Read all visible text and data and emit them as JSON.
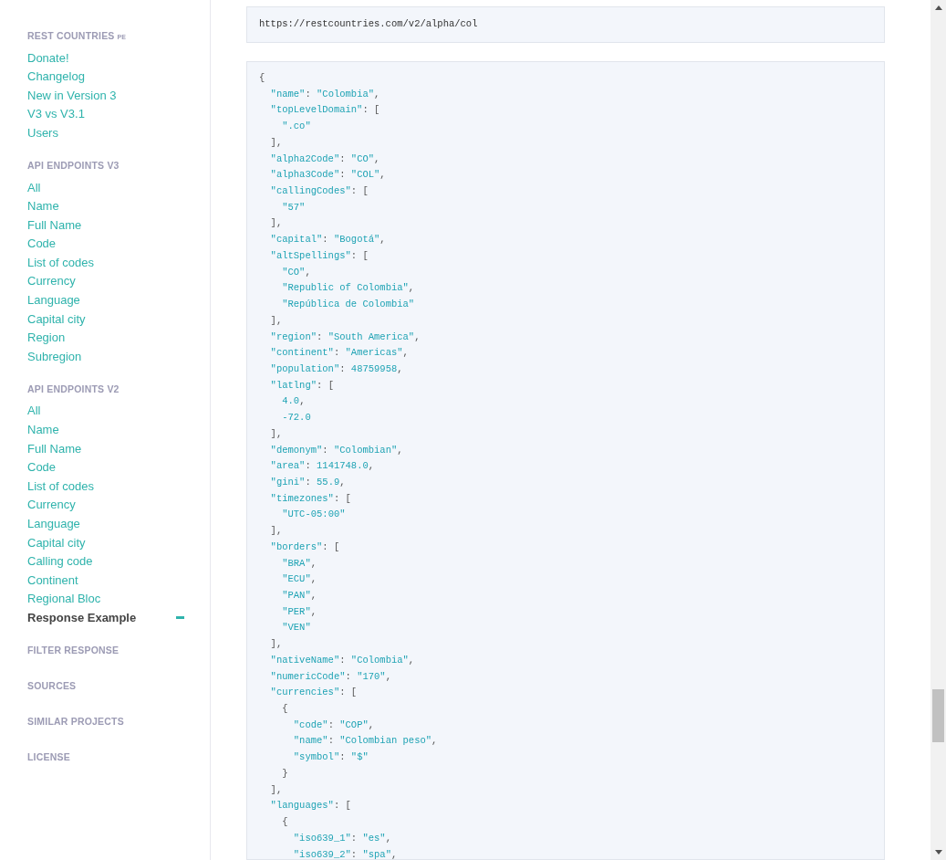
{
  "sidebar": {
    "sections": [
      {
        "title": "REST COUNTRIES",
        "title_suffix": "PE",
        "items": [
          {
            "label": "Donate!",
            "selected": false
          },
          {
            "label": "Changelog",
            "selected": false
          },
          {
            "label": "New in Version 3",
            "selected": false
          },
          {
            "label": "V3 vs V3.1",
            "selected": false
          },
          {
            "label": "Users",
            "selected": false
          }
        ]
      },
      {
        "title": "API ENDPOINTS V3",
        "items": [
          {
            "label": "All",
            "selected": false
          },
          {
            "label": "Name",
            "selected": false
          },
          {
            "label": "Full Name",
            "selected": false
          },
          {
            "label": "Code",
            "selected": false
          },
          {
            "label": "List of codes",
            "selected": false
          },
          {
            "label": "Currency",
            "selected": false
          },
          {
            "label": "Language",
            "selected": false
          },
          {
            "label": "Capital city",
            "selected": false
          },
          {
            "label": "Region",
            "selected": false
          },
          {
            "label": "Subregion",
            "selected": false
          }
        ]
      },
      {
        "title": "API ENDPOINTS V2",
        "items": [
          {
            "label": "All",
            "selected": false
          },
          {
            "label": "Name",
            "selected": false
          },
          {
            "label": "Full Name",
            "selected": false
          },
          {
            "label": "Code",
            "selected": false
          },
          {
            "label": "List of codes",
            "selected": false
          },
          {
            "label": "Currency",
            "selected": false
          },
          {
            "label": "Language",
            "selected": false
          },
          {
            "label": "Capital city",
            "selected": false
          },
          {
            "label": "Calling code",
            "selected": false
          },
          {
            "label": "Continent",
            "selected": false
          },
          {
            "label": "Regional Bloc",
            "selected": false
          },
          {
            "label": "Response Example",
            "selected": true
          }
        ]
      },
      {
        "title": "FILTER RESPONSE"
      },
      {
        "title": "SOURCES"
      },
      {
        "title": "SIMILAR PROJECTS"
      },
      {
        "title": "LICENSE"
      }
    ]
  },
  "main": {
    "url": "https://restcountries.com/v2/alpha/col",
    "code": "{\n  \"name\": \"Colombia\",\n  \"topLevelDomain\": [\n    \".co\"\n  ],\n  \"alpha2Code\": \"CO\",\n  \"alpha3Code\": \"COL\",\n  \"callingCodes\": [\n    \"57\"\n  ],\n  \"capital\": \"Bogotá\",\n  \"altSpellings\": [\n    \"CO\",\n    \"Republic of Colombia\",\n    \"República de Colombia\"\n  ],\n  \"region\": \"South America\",\n  \"continent\": \"Americas\",\n  \"population\": 48759958,\n  \"latlng\": [\n    4.0,\n    -72.0\n  ],\n  \"demonym\": \"Colombian\",\n  \"area\": 1141748.0,\n  \"gini\": 55.9,\n  \"timezones\": [\n    \"UTC-05:00\"\n  ],\n  \"borders\": [\n    \"BRA\",\n    \"ECU\",\n    \"PAN\",\n    \"PER\",\n    \"VEN\"\n  ],\n  \"nativeName\": \"Colombia\",\n  \"numericCode\": \"170\",\n  \"currencies\": [\n    {\n      \"code\": \"COP\",\n      \"name\": \"Colombian peso\",\n      \"symbol\": \"$\"\n    }\n  ],\n  \"languages\": [\n    {\n      \"iso639_1\": \"es\",\n      \"iso639_2\": \"spa\","
  }
}
